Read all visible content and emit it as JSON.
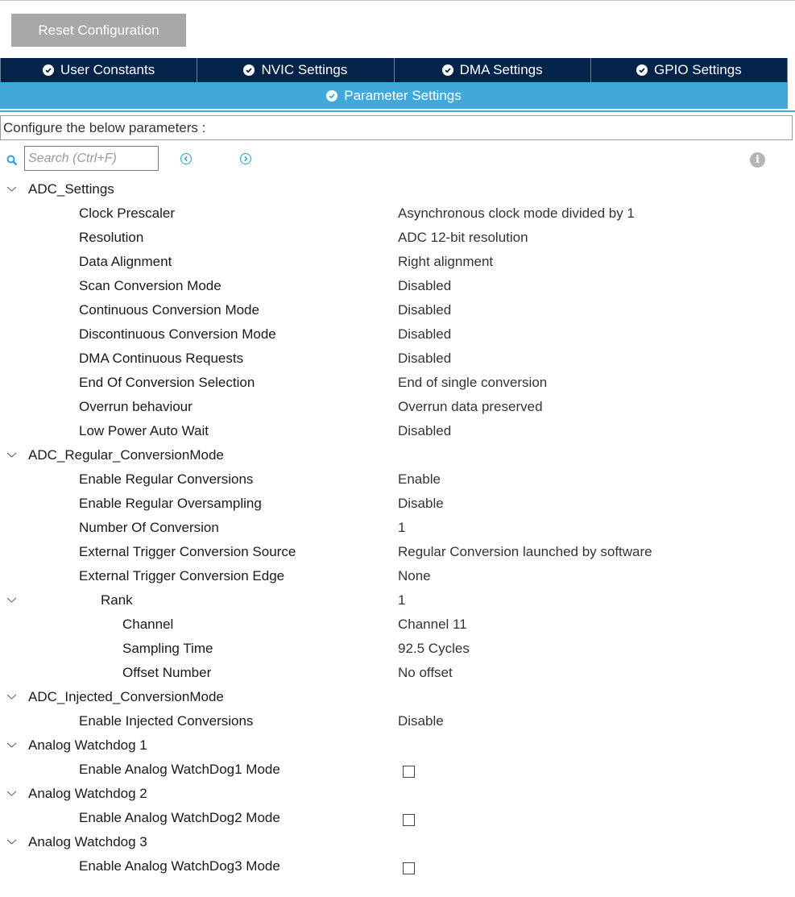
{
  "toolbar": {
    "reset_label": "Reset Configuration"
  },
  "tabs": [
    {
      "label": "User Constants"
    },
    {
      "label": "NVIC Settings"
    },
    {
      "label": "DMA Settings"
    },
    {
      "label": "GPIO Settings"
    }
  ],
  "active_tab": {
    "label": "Parameter Settings"
  },
  "configure_text": "Configure the below parameters :",
  "search": {
    "placeholder": "Search (Ctrl+F)",
    "value": ""
  },
  "colors": {
    "tab_dark": "#03234b",
    "tab_active": "#3fa9dc",
    "reset_button": "#a8a8a8"
  },
  "tree": {
    "adc_settings": {
      "title": "ADC_Settings",
      "items": [
        {
          "label": "Clock Prescaler",
          "value": "Asynchronous clock mode divided by 1"
        },
        {
          "label": "Resolution",
          "value": "ADC 12-bit resolution"
        },
        {
          "label": "Data Alignment",
          "value": "Right alignment"
        },
        {
          "label": "Scan Conversion Mode",
          "value": "Disabled"
        },
        {
          "label": "Continuous Conversion Mode",
          "value": "Disabled"
        },
        {
          "label": "Discontinuous Conversion Mode",
          "value": "Disabled"
        },
        {
          "label": "DMA Continuous Requests",
          "value": "Disabled"
        },
        {
          "label": "End Of Conversion Selection",
          "value": "End of single conversion"
        },
        {
          "label": "Overrun behaviour",
          "value": "Overrun data preserved"
        },
        {
          "label": "Low Power Auto Wait",
          "value": "Disabled"
        }
      ]
    },
    "regular": {
      "title": "ADC_Regular_ConversionMode",
      "items": [
        {
          "label": "Enable Regular Conversions",
          "value": "Enable"
        },
        {
          "label": "Enable Regular Oversampling",
          "value": "Disable"
        },
        {
          "label": "Number Of Conversion",
          "value": "1"
        },
        {
          "label": "External Trigger Conversion Source",
          "value": "Regular Conversion launched by software"
        },
        {
          "label": "External Trigger Conversion Edge",
          "value": "None"
        }
      ],
      "rank": {
        "label": "Rank",
        "value": "1",
        "items": [
          {
            "label": "Channel",
            "value": "Channel 11"
          },
          {
            "label": "Sampling Time",
            "value": "92.5 Cycles"
          },
          {
            "label": "Offset Number",
            "value": "No offset"
          }
        ]
      }
    },
    "injected": {
      "title": "ADC_Injected_ConversionMode",
      "items": [
        {
          "label": "Enable Injected Conversions",
          "value": "Disable"
        }
      ]
    },
    "watchdog1": {
      "title": "Analog Watchdog 1",
      "label": "Enable Analog WatchDog1 Mode",
      "checked": false
    },
    "watchdog2": {
      "title": "Analog Watchdog 2",
      "label": "Enable Analog WatchDog2 Mode",
      "checked": false
    },
    "watchdog3": {
      "title": "Analog Watchdog 3",
      "label": "Enable Analog WatchDog3 Mode",
      "checked": false
    }
  }
}
